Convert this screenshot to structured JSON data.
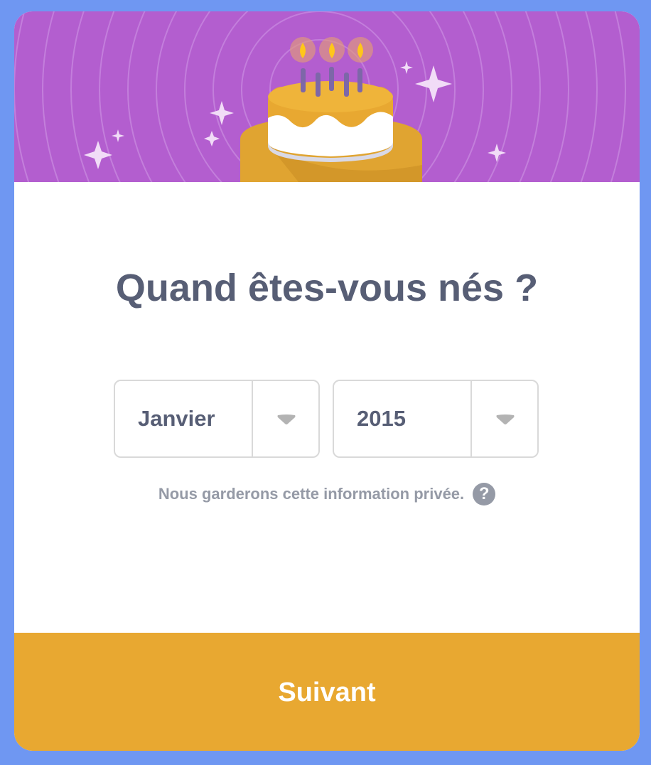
{
  "dialog": {
    "title": "Quand êtes-vous nés ?",
    "month_select": {
      "value": "Janvier",
      "icon": "caret-down-icon"
    },
    "year_select": {
      "value": "2015",
      "icon": "caret-down-icon"
    },
    "privacy_note": "Nous garderons cette information privée.",
    "help_icon": {
      "name": "question-mark-icon",
      "glyph": "?"
    },
    "next_button": "Suivant"
  },
  "theme": {
    "frame_blue": "#6f97f2",
    "banner_purple": "#b35ecf",
    "cake_gold": "#e8a831",
    "text_dark": "#575e75",
    "text_muted": "#959aa6",
    "border_grey": "#d9d9d9"
  }
}
